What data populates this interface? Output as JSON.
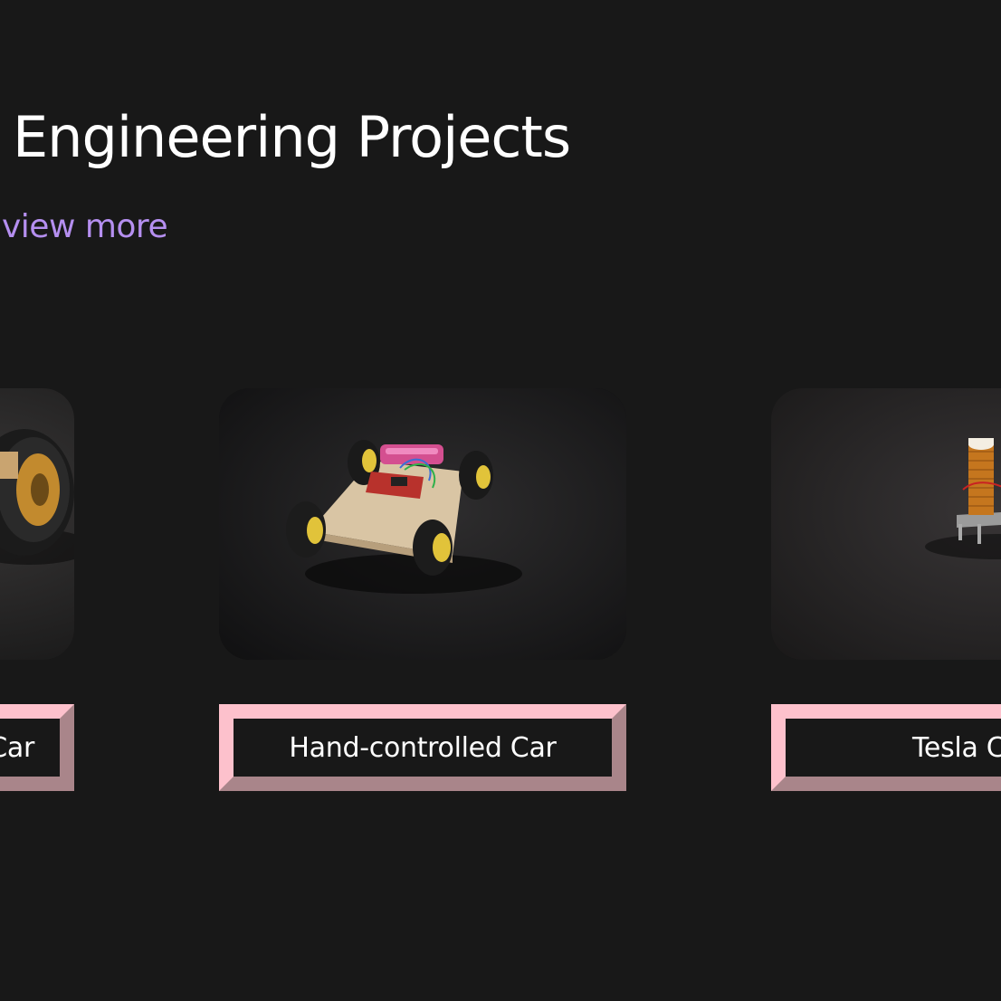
{
  "section": {
    "title": "Engineering Projects",
    "view_more": "view more"
  },
  "projects": [
    {
      "label": "Car",
      "image": "robot-car-wheel-photo"
    },
    {
      "label": "Hand-controlled Car",
      "image": "robot-car-chassis-photo"
    },
    {
      "label": "Tesla C",
      "image": "tesla-coil-photo"
    }
  ],
  "colors": {
    "background": "#181818",
    "accent_link": "#b58ff0",
    "button_border_light": "#fdc1cc",
    "button_border_dark": "#a9858a"
  }
}
